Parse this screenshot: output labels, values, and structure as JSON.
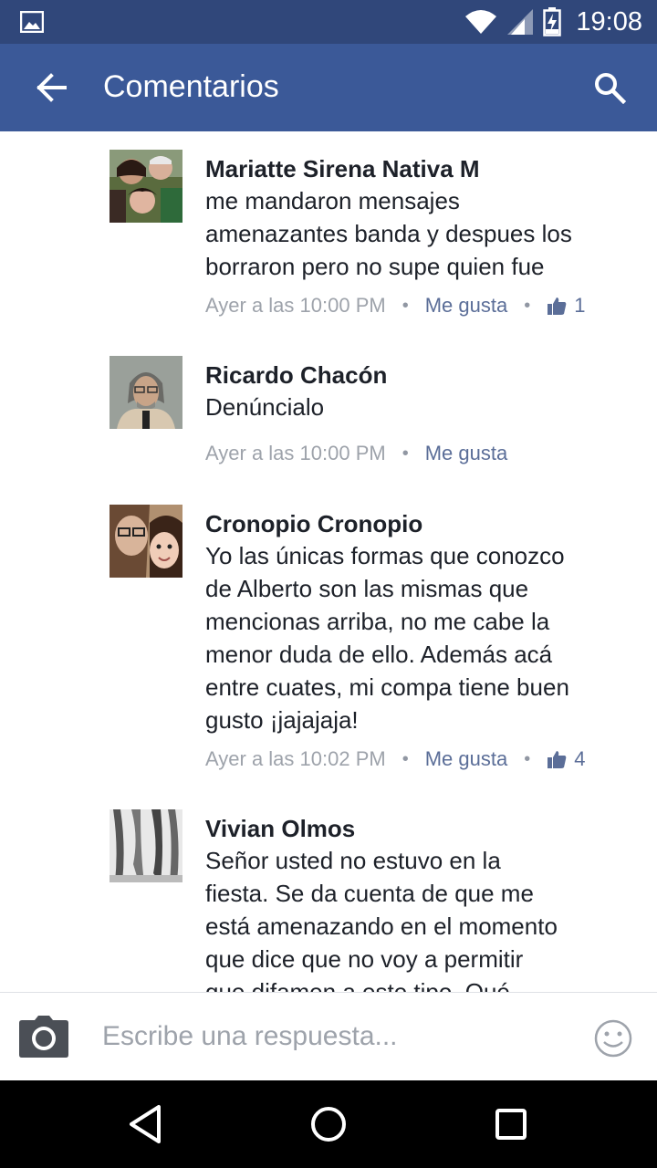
{
  "status_bar": {
    "time": "19:08",
    "battery_level": 0.2
  },
  "app_bar": {
    "title": "Comentarios"
  },
  "comments": [
    {
      "author": "Mariatte Sirena Nativa M",
      "lines": [
        "me mandaron mensajes",
        "amenazantes banda y despues los",
        "borraron pero no supe quien fue"
      ],
      "time": "Ayer a las 10:00 PM",
      "like_label": "Me gusta",
      "likes": "1"
    },
    {
      "author": "Ricardo Chacón",
      "lines": [
        "Denúncialo"
      ],
      "time": "Ayer a las 10:00 PM",
      "like_label": "Me gusta",
      "likes": ""
    },
    {
      "author": "Cronopio Cronopio",
      "lines": [
        "Yo las únicas formas que conozco",
        "de Alberto son las mismas que",
        "mencionas arriba, no me cabe la",
        "menor duda de ello. Además acá",
        "entre cuates, mi compa tiene buen",
        "gusto ¡jajajaja!"
      ],
      "time": "Ayer a las 10:02 PM",
      "like_label": "Me gusta",
      "likes": "4"
    },
    {
      "author": "Vivian Olmos",
      "lines": [
        "Señor usted no estuvo en la",
        "fiesta. Se da cuenta de que me",
        "está amenazando en el momento",
        "que dice que no voy a permitir",
        "que difamen a este tipo. Qué"
      ],
      "time": "",
      "like_label": "",
      "likes": ""
    }
  ],
  "reply": {
    "placeholder": "Escribe una respuesta..."
  },
  "icons": {
    "status_left": "image-icon",
    "wifi": "wifi-icon",
    "signal": "cell-signal-icon",
    "battery": "battery-charging-icon",
    "back": "arrow-back-icon",
    "search": "search-icon",
    "like": "thumbs-up-icon",
    "camera": "camera-icon",
    "emoji": "smiley-icon",
    "nav_back": "nav-back-icon",
    "nav_home": "nav-home-icon",
    "nav_recents": "nav-recents-icon"
  },
  "colors": {
    "status_bar": "#30477a",
    "app_bar": "#3b5998",
    "link": "#5b6e98",
    "text": "#1d2129",
    "meta": "#9ea3ab"
  }
}
